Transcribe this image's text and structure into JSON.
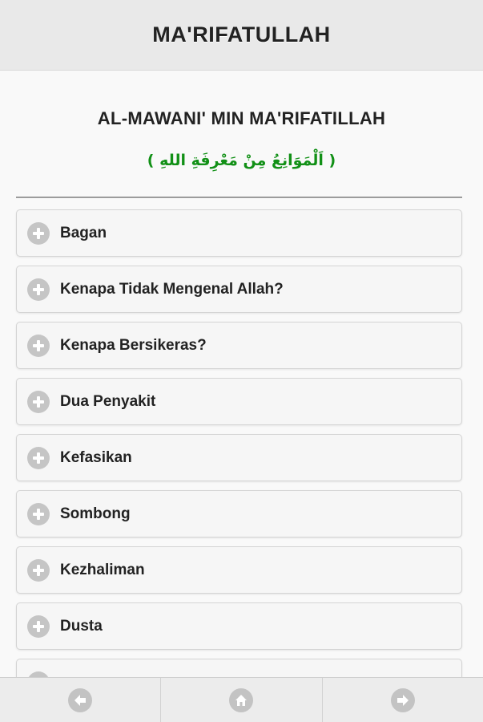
{
  "header": {
    "title": "MA'RIFATULLAH"
  },
  "section": {
    "title": "AL-MAWANI' MIN MA'RIFATILLAH",
    "arabic": "( اَلْمَوَانِعُ مِنْ مَعْرِفَةِ اللهِ )"
  },
  "items": [
    {
      "label": "Bagan",
      "icon": "plus-circle-icon"
    },
    {
      "label": "Kenapa Tidak Mengenal Allah?",
      "icon": "plus-circle-icon"
    },
    {
      "label": "Kenapa Bersikeras?",
      "icon": "plus-circle-icon"
    },
    {
      "label": "Dua Penyakit",
      "icon": "plus-circle-icon"
    },
    {
      "label": "Kefasikan",
      "icon": "plus-circle-icon"
    },
    {
      "label": "Sombong",
      "icon": "plus-circle-icon"
    },
    {
      "label": "Kezhaliman",
      "icon": "plus-circle-icon"
    },
    {
      "label": "Dusta",
      "icon": "plus-circle-icon"
    },
    {
      "label": "",
      "icon": "plus-circle-icon"
    }
  ],
  "footer": {
    "buttons": [
      {
        "icon": "arrow-left-icon"
      },
      {
        "icon": "home-icon"
      },
      {
        "icon": "arrow-right-icon"
      }
    ]
  },
  "colors": {
    "header_bg": "#e9e9e9",
    "arabic_text": "#119016",
    "icon_gray": "#c5c5c5"
  }
}
